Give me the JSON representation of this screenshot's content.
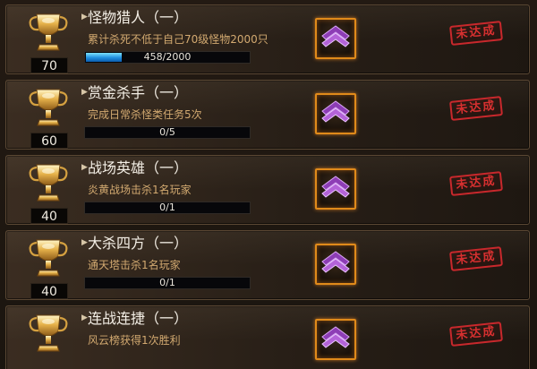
{
  "achievements": [
    {
      "title": "怪物猎人（一）",
      "description": "累计杀死不低于自己70级怪物2000只",
      "points": "70",
      "progress_text": "458/2000",
      "progress_fraction": 0.229,
      "status": "未达成"
    },
    {
      "title": "赏金杀手（一）",
      "description": "完成日常杀怪类任务5次",
      "points": "60",
      "progress_text": "0/5",
      "progress_fraction": 0,
      "status": "未达成"
    },
    {
      "title": "战场英雄（一）",
      "description": "炎黄战场击杀1名玩家",
      "points": "40",
      "progress_text": "0/1",
      "progress_fraction": 0,
      "status": "未达成"
    },
    {
      "title": "大杀四方（一）",
      "description": "通天塔击杀1名玩家",
      "points": "40",
      "progress_text": "0/1",
      "progress_fraction": 0,
      "status": "未达成"
    },
    {
      "title": "连战连捷（一）",
      "description": "风云榜获得1次胜利",
      "points": "",
      "progress_text": "",
      "progress_fraction": 0,
      "status": "未达成"
    }
  ],
  "icons": {
    "trophy": "trophy-icon",
    "reward": "purple-chevron-reward-icon"
  },
  "colors": {
    "progress_fill": "#1f8fe0",
    "reward_border": "#e08a1a",
    "stamp_red": "#c8282c",
    "description_text": "#d2a970"
  }
}
